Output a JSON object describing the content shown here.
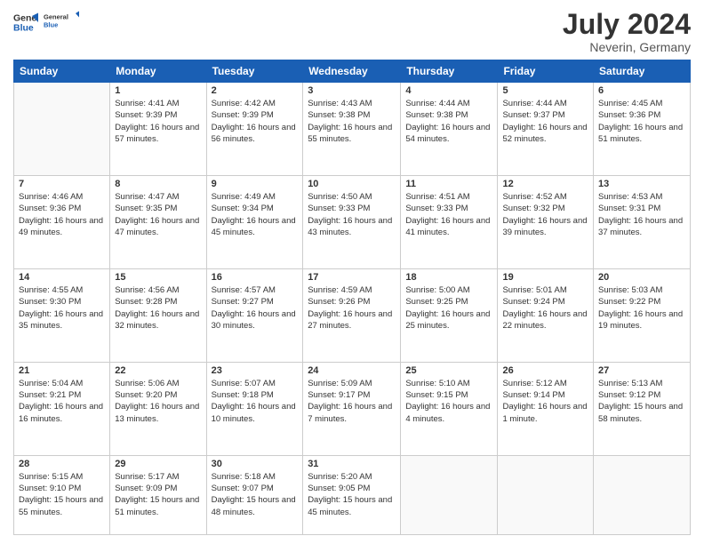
{
  "logo": {
    "line1": "General",
    "line2": "Blue"
  },
  "title": "July 2024",
  "subtitle": "Neverin, Germany",
  "header": {
    "days": [
      "Sunday",
      "Monday",
      "Tuesday",
      "Wednesday",
      "Thursday",
      "Friday",
      "Saturday"
    ]
  },
  "weeks": [
    {
      "cells": [
        {
          "day": "",
          "info": ""
        },
        {
          "day": "1",
          "info": "Sunrise: 4:41 AM\nSunset: 9:39 PM\nDaylight: 16 hours\nand 57 minutes."
        },
        {
          "day": "2",
          "info": "Sunrise: 4:42 AM\nSunset: 9:39 PM\nDaylight: 16 hours\nand 56 minutes."
        },
        {
          "day": "3",
          "info": "Sunrise: 4:43 AM\nSunset: 9:38 PM\nDaylight: 16 hours\nand 55 minutes."
        },
        {
          "day": "4",
          "info": "Sunrise: 4:44 AM\nSunset: 9:38 PM\nDaylight: 16 hours\nand 54 minutes."
        },
        {
          "day": "5",
          "info": "Sunrise: 4:44 AM\nSunset: 9:37 PM\nDaylight: 16 hours\nand 52 minutes."
        },
        {
          "day": "6",
          "info": "Sunrise: 4:45 AM\nSunset: 9:36 PM\nDaylight: 16 hours\nand 51 minutes."
        }
      ]
    },
    {
      "cells": [
        {
          "day": "7",
          "info": "Sunrise: 4:46 AM\nSunset: 9:36 PM\nDaylight: 16 hours\nand 49 minutes."
        },
        {
          "day": "8",
          "info": "Sunrise: 4:47 AM\nSunset: 9:35 PM\nDaylight: 16 hours\nand 47 minutes."
        },
        {
          "day": "9",
          "info": "Sunrise: 4:49 AM\nSunset: 9:34 PM\nDaylight: 16 hours\nand 45 minutes."
        },
        {
          "day": "10",
          "info": "Sunrise: 4:50 AM\nSunset: 9:33 PM\nDaylight: 16 hours\nand 43 minutes."
        },
        {
          "day": "11",
          "info": "Sunrise: 4:51 AM\nSunset: 9:33 PM\nDaylight: 16 hours\nand 41 minutes."
        },
        {
          "day": "12",
          "info": "Sunrise: 4:52 AM\nSunset: 9:32 PM\nDaylight: 16 hours\nand 39 minutes."
        },
        {
          "day": "13",
          "info": "Sunrise: 4:53 AM\nSunset: 9:31 PM\nDaylight: 16 hours\nand 37 minutes."
        }
      ]
    },
    {
      "cells": [
        {
          "day": "14",
          "info": "Sunrise: 4:55 AM\nSunset: 9:30 PM\nDaylight: 16 hours\nand 35 minutes."
        },
        {
          "day": "15",
          "info": "Sunrise: 4:56 AM\nSunset: 9:28 PM\nDaylight: 16 hours\nand 32 minutes."
        },
        {
          "day": "16",
          "info": "Sunrise: 4:57 AM\nSunset: 9:27 PM\nDaylight: 16 hours\nand 30 minutes."
        },
        {
          "day": "17",
          "info": "Sunrise: 4:59 AM\nSunset: 9:26 PM\nDaylight: 16 hours\nand 27 minutes."
        },
        {
          "day": "18",
          "info": "Sunrise: 5:00 AM\nSunset: 9:25 PM\nDaylight: 16 hours\nand 25 minutes."
        },
        {
          "day": "19",
          "info": "Sunrise: 5:01 AM\nSunset: 9:24 PM\nDaylight: 16 hours\nand 22 minutes."
        },
        {
          "day": "20",
          "info": "Sunrise: 5:03 AM\nSunset: 9:22 PM\nDaylight: 16 hours\nand 19 minutes."
        }
      ]
    },
    {
      "cells": [
        {
          "day": "21",
          "info": "Sunrise: 5:04 AM\nSunset: 9:21 PM\nDaylight: 16 hours\nand 16 minutes."
        },
        {
          "day": "22",
          "info": "Sunrise: 5:06 AM\nSunset: 9:20 PM\nDaylight: 16 hours\nand 13 minutes."
        },
        {
          "day": "23",
          "info": "Sunrise: 5:07 AM\nSunset: 9:18 PM\nDaylight: 16 hours\nand 10 minutes."
        },
        {
          "day": "24",
          "info": "Sunrise: 5:09 AM\nSunset: 9:17 PM\nDaylight: 16 hours\nand 7 minutes."
        },
        {
          "day": "25",
          "info": "Sunrise: 5:10 AM\nSunset: 9:15 PM\nDaylight: 16 hours\nand 4 minutes."
        },
        {
          "day": "26",
          "info": "Sunrise: 5:12 AM\nSunset: 9:14 PM\nDaylight: 16 hours\nand 1 minute."
        },
        {
          "day": "27",
          "info": "Sunrise: 5:13 AM\nSunset: 9:12 PM\nDaylight: 15 hours\nand 58 minutes."
        }
      ]
    },
    {
      "cells": [
        {
          "day": "28",
          "info": "Sunrise: 5:15 AM\nSunset: 9:10 PM\nDaylight: 15 hours\nand 55 minutes."
        },
        {
          "day": "29",
          "info": "Sunrise: 5:17 AM\nSunset: 9:09 PM\nDaylight: 15 hours\nand 51 minutes."
        },
        {
          "day": "30",
          "info": "Sunrise: 5:18 AM\nSunset: 9:07 PM\nDaylight: 15 hours\nand 48 minutes."
        },
        {
          "day": "31",
          "info": "Sunrise: 5:20 AM\nSunset: 9:05 PM\nDaylight: 15 hours\nand 45 minutes."
        },
        {
          "day": "",
          "info": ""
        },
        {
          "day": "",
          "info": ""
        },
        {
          "day": "",
          "info": ""
        }
      ]
    }
  ]
}
